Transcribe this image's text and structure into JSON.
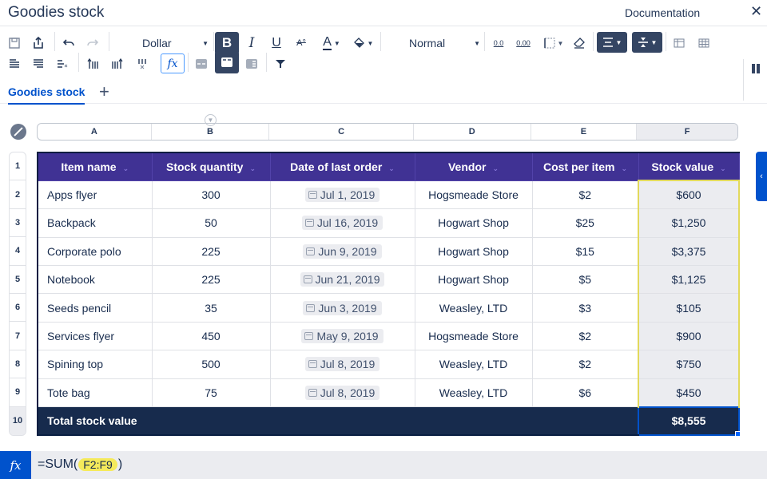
{
  "app": {
    "title": "Goodies stock",
    "documentation_label": "Documentation",
    "close_icon": "✕"
  },
  "toolbar": {
    "number_format": "Dollar",
    "text_style": "Normal",
    "bold_label": "B",
    "italic_label": "I",
    "underline_label": "U",
    "font_color_label": "A",
    "fx_label": "fx",
    "decrease_decimals_label": "0.0",
    "increase_decimals_label": "0.00",
    "icons": [
      "save-icon",
      "export-icon",
      "undo-icon",
      "redo-icon",
      "bold-icon",
      "italic-icon",
      "underline-icon",
      "strikethrough-icon",
      "font-color-icon",
      "fill-color-icon",
      "decrease-decimals-icon",
      "increase-decimals-icon",
      "borders-icon",
      "clear-format-icon",
      "horizontal-align-icon",
      "vertical-align-icon",
      "freeze-rows-icon",
      "freeze-cols-icon",
      "insert-row-above-icon",
      "insert-row-below-icon",
      "delete-row-icon",
      "insert-col-left-icon",
      "insert-col-right-icon",
      "delete-col-icon",
      "function-icon",
      "header-row-icon",
      "header-row-active-icon",
      "header-col-icon",
      "filter-icon",
      "side-panel-icon"
    ]
  },
  "tabs": {
    "active": "Goodies stock",
    "add_icon": "+"
  },
  "columns": [
    "A",
    "B",
    "C",
    "D",
    "E",
    "F"
  ],
  "rows": [
    "1",
    "2",
    "3",
    "4",
    "5",
    "6",
    "7",
    "8",
    "9",
    "10"
  ],
  "table": {
    "headers": [
      "Item name",
      "Stock quantity",
      "Date of last order",
      "Vendor",
      "Cost per item",
      "Stock value"
    ],
    "rows": [
      {
        "item": "Apps flyer",
        "qty": "300",
        "date": "Jul 1, 2019",
        "vendor": "Hogsmeade Store",
        "cost": "$2",
        "value": "$600"
      },
      {
        "item": "Backpack",
        "qty": "50",
        "date": "Jul 16, 2019",
        "vendor": "Hogwart Shop",
        "cost": "$25",
        "value": "$1,250"
      },
      {
        "item": "Corporate polo",
        "qty": "225",
        "date": "Jun 9, 2019",
        "vendor": "Hogwart Shop",
        "cost": "$15",
        "value": "$3,375"
      },
      {
        "item": "Notebook",
        "qty": "225",
        "date": "Jun 21, 2019",
        "vendor": "Hogwart Shop",
        "cost": "$5",
        "value": "$1,125"
      },
      {
        "item": "Seeds pencil",
        "qty": "35",
        "date": "Jun 3, 2019",
        "vendor": "Weasley, LTD",
        "cost": "$3",
        "value": "$105"
      },
      {
        "item": "Services flyer",
        "qty": "450",
        "date": "May 9, 2019",
        "vendor": "Hogsmeade Store",
        "cost": "$2",
        "value": "$900"
      },
      {
        "item": "Spining top",
        "qty": "500",
        "date": "Jul 8, 2019",
        "vendor": "Weasley, LTD",
        "cost": "$2",
        "value": "$750"
      },
      {
        "item": "Tote bag",
        "qty": "75",
        "date": "Jul 8, 2019",
        "vendor": "Weasley, LTD",
        "cost": "$6",
        "value": "$450"
      }
    ],
    "total_label": "Total stock value",
    "total_value": "$8,555"
  },
  "formula_bar": {
    "fx_label": "fx",
    "prefix": "=SUM(",
    "range_ref": "F2:F9",
    "suffix": ")"
  },
  "colors": {
    "header_bg": "#403294",
    "total_bg": "#172b4d",
    "accent": "#0052cc",
    "selection_border": "#e2d95c"
  }
}
